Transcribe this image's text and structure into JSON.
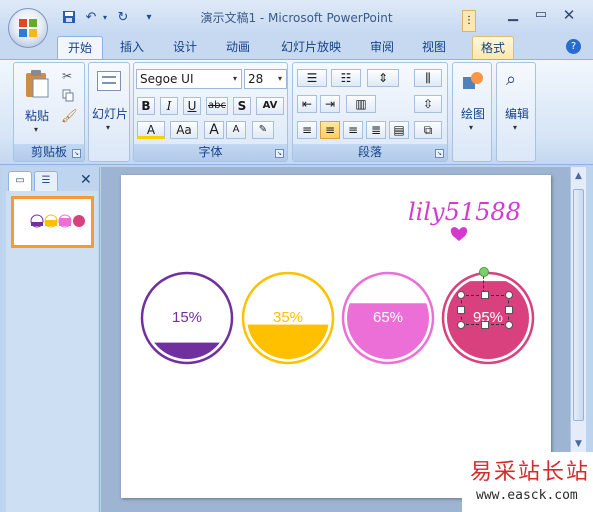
{
  "title_bar": {
    "title": "演示文稿1 - Microsoft PowerPoint"
  },
  "tabs": [
    "开始",
    "插入",
    "设计",
    "动画",
    "幻灯片放映",
    "审阅",
    "视图",
    "格式"
  ],
  "active_tab": "开始",
  "ribbon": {
    "clipboard": {
      "paste_label": "粘贴",
      "group_label": "剪贴板"
    },
    "slides": {
      "slide_label": "幻灯片"
    },
    "font": {
      "font_name": "Segoe UI",
      "font_size": "28",
      "group_label": "字体",
      "bold": "B",
      "italic": "I",
      "underline": "U",
      "strike": "abc",
      "shadow": "S",
      "spacing": "AV",
      "color": "A",
      "case": "Aa",
      "grow": "A",
      "shrink": "A"
    },
    "paragraph": {
      "group_label": "段落"
    },
    "drawing": {
      "label": "绘图"
    },
    "editing": {
      "label": "编辑"
    }
  },
  "thumbnail": {
    "slide_number": "1"
  },
  "slide": {
    "signature": "lily51588",
    "circles": [
      {
        "label": "15%",
        "fill_level": 0.2,
        "color": "#7030a0",
        "text_color": "#7030a0"
      },
      {
        "label": "35%",
        "fill_level": 0.42,
        "color": "#ffc000",
        "text_color": "#ffc000"
      },
      {
        "label": "65%",
        "fill_level": 0.68,
        "color": "#ec6fd7",
        "text_color": "#ffffff"
      },
      {
        "label": "95%",
        "fill_level": 0.95,
        "color": "#d9417e",
        "text_color": "#ffffff"
      }
    ]
  },
  "watermark": {
    "cn": "易采站长站",
    "url": "www.easck.com"
  },
  "colors": {
    "accent": "#15428b",
    "selection_orange": "#f59a35"
  }
}
